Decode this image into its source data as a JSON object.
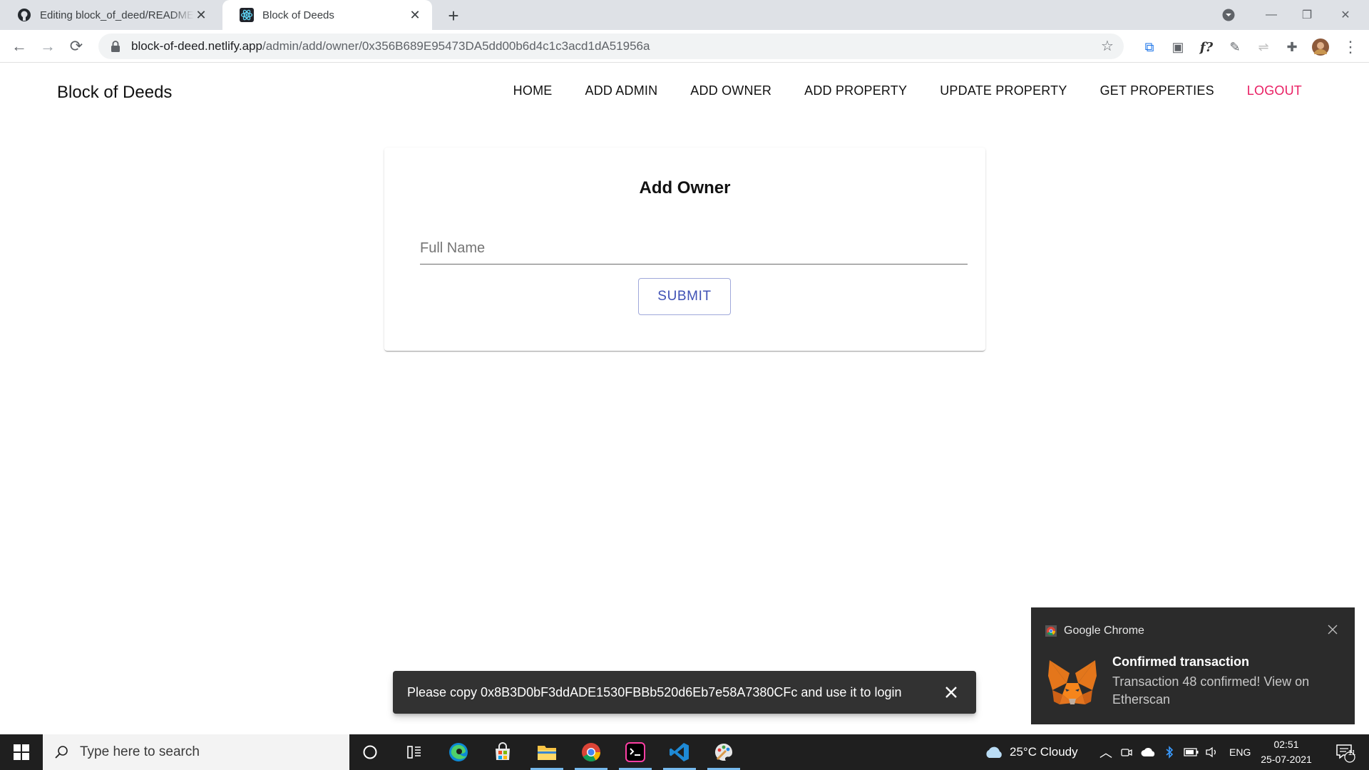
{
  "browser": {
    "tabs": [
      {
        "title": "Editing block_of_deed/README.md",
        "active": false,
        "icon": "github-icon"
      },
      {
        "title": "Block of Deeds",
        "active": true,
        "icon": "react-icon"
      }
    ],
    "url_host": "block-of-deed.netlify.app",
    "url_path": "/admin/add/owner/0x356B689E95473DA5dd00b6d4c1c3acd1dA51956a"
  },
  "app": {
    "brand": "Block of Deeds",
    "nav": [
      "HOME",
      "ADD ADMIN",
      "ADD OWNER",
      "ADD PROPERTY",
      "UPDATE PROPERTY",
      "GET PROPERTIES",
      "LOGOUT"
    ],
    "logout_color": "#e91e63"
  },
  "form": {
    "title": "Add Owner",
    "name_placeholder": "Full Name",
    "name_value": "",
    "submit_label": "SUBMIT",
    "accent_color": "#3f51b5"
  },
  "snackbar": {
    "message": "Please copy 0x8B3D0bF3ddADE1530FBBb520d6Eb7e58A7380CFc and use it to login"
  },
  "notification": {
    "app": "Google Chrome",
    "title": "Confirmed transaction",
    "body": "Transaction 48 confirmed! View on Etherscan"
  },
  "taskbar": {
    "search_placeholder": "Type here to search",
    "weather": "25°C  Cloudy",
    "language": "ENG",
    "time": "02:51",
    "date": "25-07-2021",
    "notification_count": "11"
  }
}
